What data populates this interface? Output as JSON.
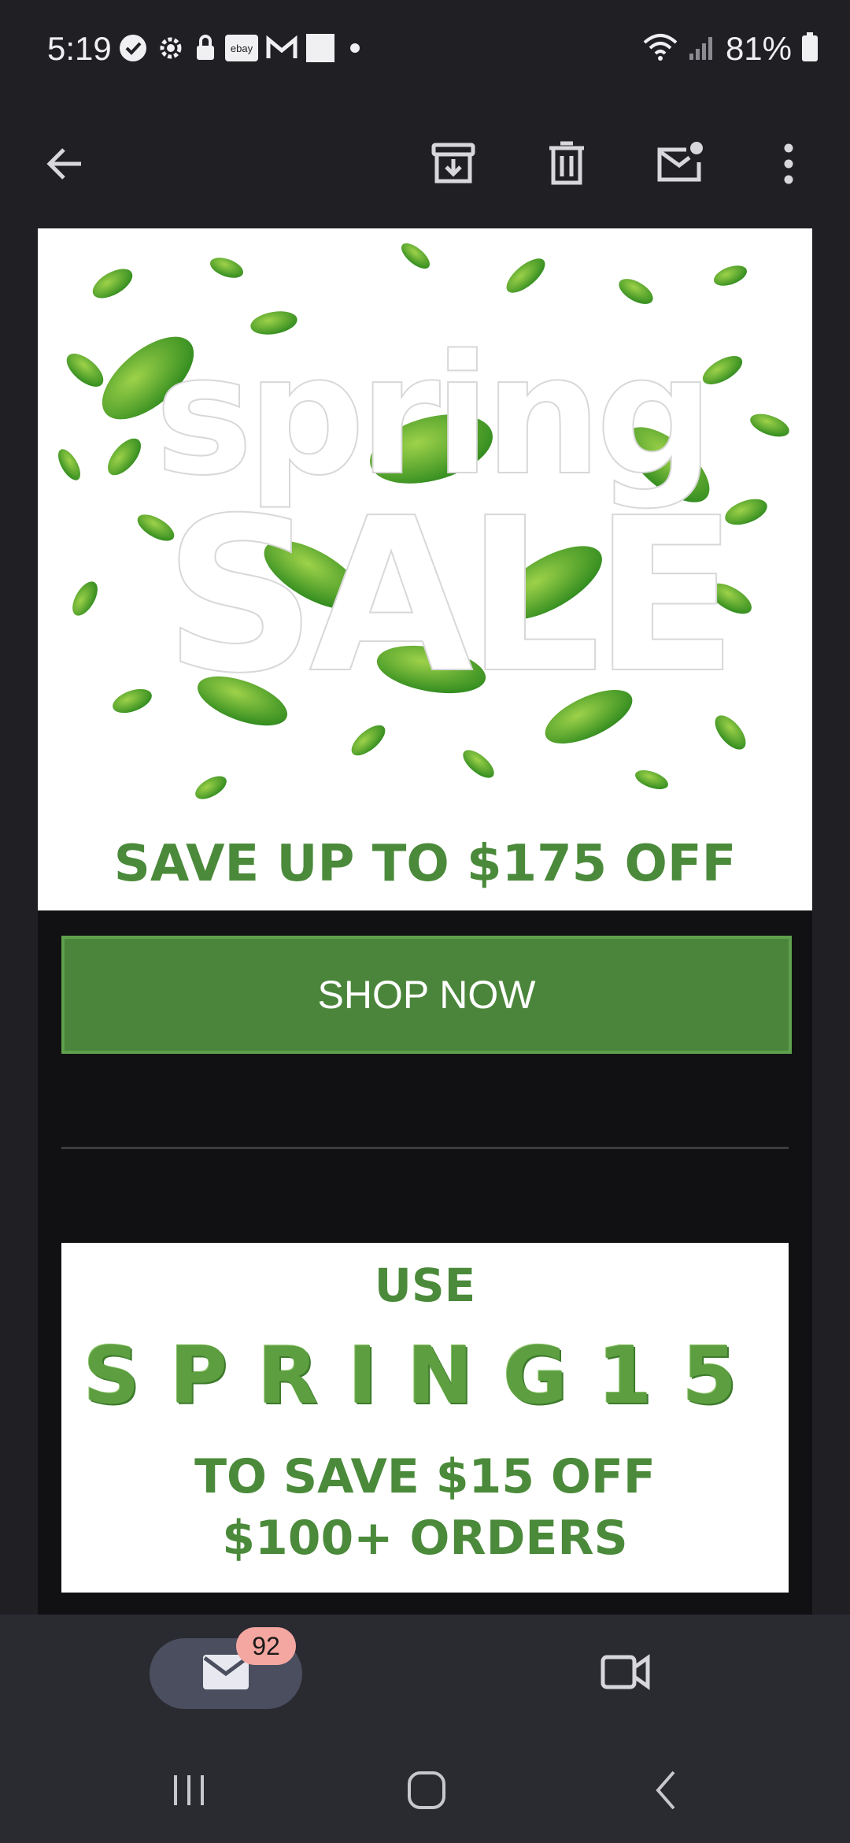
{
  "status": {
    "time": "5:19",
    "battery": "81%",
    "notification_icons": [
      "verified-icon",
      "settings-icon",
      "lock-icon",
      "ebay-icon",
      "gmail-icon",
      "white-square-icon",
      "dot-icon"
    ]
  },
  "toolbar": {
    "back_icon": "arrow-left-icon",
    "archive_icon": "archive-icon",
    "delete_icon": "trash-icon",
    "mark_unread_icon": "mail-unread-icon",
    "more_icon": "more-vert-icon"
  },
  "email": {
    "hero_title_1": "spring",
    "hero_title_2": "SALE",
    "hero_save": "SAVE UP TO $175 OFF",
    "shop_button": "SHOP NOW",
    "promo_use": "USE",
    "promo_code": "SPRING15",
    "promo_line1": "TO SAVE $15 OFF",
    "promo_line2": "$100+ ORDERS"
  },
  "bottom_nav": {
    "mail_badge": "92",
    "mail_icon": "mail-icon",
    "meet_icon": "video-icon"
  },
  "system_nav": {
    "recents_icon": "recents-icon",
    "home_icon": "home-icon",
    "back_icon": "back-chevron-icon"
  },
  "colors": {
    "accent_green": "#4b853b",
    "background": "#1f1f24",
    "badge": "#f4a6a0"
  }
}
